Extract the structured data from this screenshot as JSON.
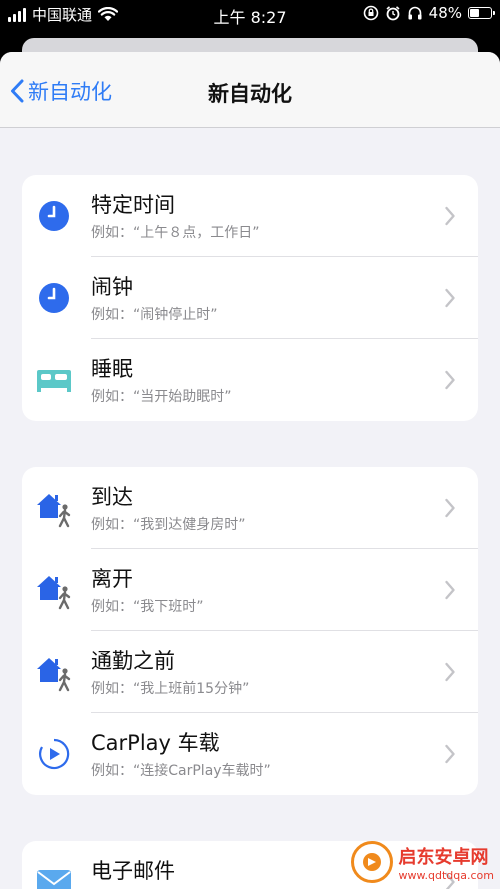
{
  "status_bar": {
    "carrier": "中国联通",
    "time": "上午 8:27",
    "battery": "48%",
    "battery_level": 0.48
  },
  "nav": {
    "back_label": "新自动化",
    "title": "新自动化"
  },
  "groups": [
    {
      "rows": [
        {
          "title": "特定时间",
          "subtitle": "例如：“上午８点，工作日”",
          "icon": "clock-icon"
        },
        {
          "title": "闹钟",
          "subtitle": "例如：“闹钟停止时”",
          "icon": "clock-icon"
        },
        {
          "title": "睡眠",
          "subtitle": "例如：“当开始助眠时”",
          "icon": "bed-icon"
        }
      ]
    },
    {
      "rows": [
        {
          "title": "到达",
          "subtitle": "例如：“我到达健身房时”",
          "icon": "home-person-icon"
        },
        {
          "title": "离开",
          "subtitle": "例如：“我下班时”",
          "icon": "home-person-icon"
        },
        {
          "title": "通勤之前",
          "subtitle": "例如：“我上班前15分钟”",
          "icon": "home-person-icon"
        },
        {
          "title": "CarPlay 车载",
          "subtitle": "例如：“连接CarPlay车载时”",
          "icon": "carplay-icon"
        }
      ]
    },
    {
      "rows": [
        {
          "title": "电子邮件",
          "subtitle": "",
          "icon": "mail-icon"
        }
      ]
    }
  ],
  "watermark": {
    "name": "启东安卓网",
    "url": "www.qdtdqa.com"
  },
  "colors": {
    "accent": "#2f7cf6",
    "clock_blue": "#2e6bec",
    "bed_teal": "#5bc8c8",
    "house_blue": "#2a64e6"
  }
}
